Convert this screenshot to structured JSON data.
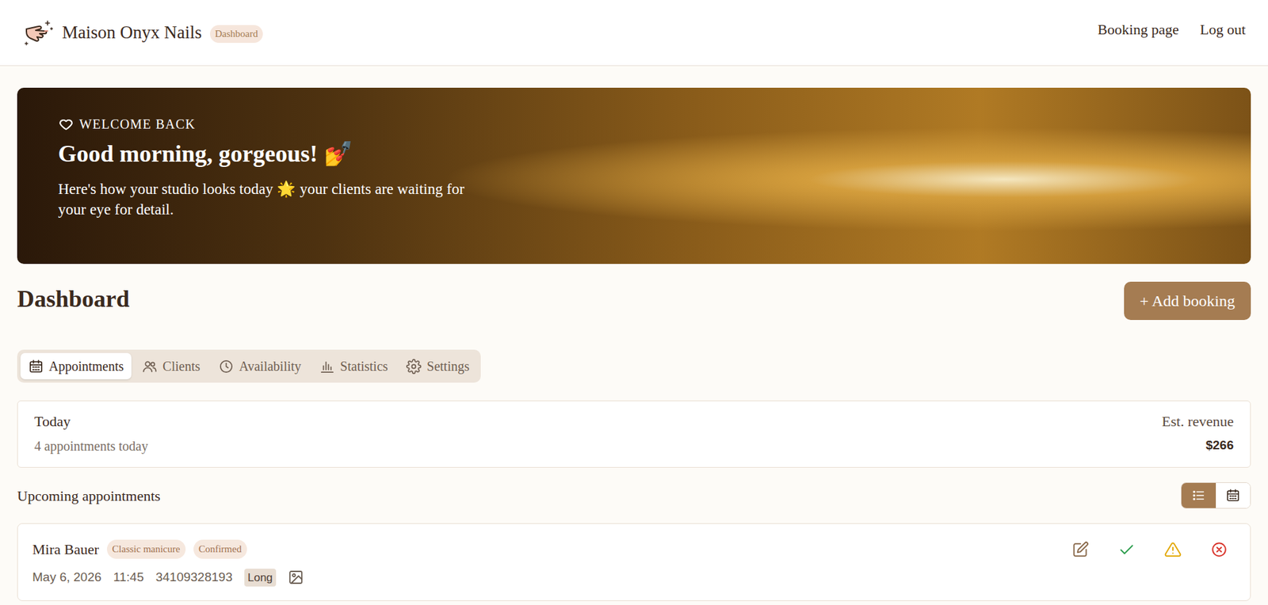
{
  "header": {
    "brand": "Maison Onyx Nails",
    "badge": "Dashboard",
    "nav": [
      "Booking page",
      "Log out"
    ]
  },
  "hero": {
    "eyebrow": "WELCOME BACK",
    "title": "Good morning, gorgeous! 💅",
    "subtitle": "Here's how your studio looks today 🌟 your clients are waiting for your eye for detail."
  },
  "page": {
    "title": "Dashboard",
    "add_button": "+ Add booking"
  },
  "tabs": [
    {
      "label": "Appointments",
      "selected": true
    },
    {
      "label": "Clients",
      "selected": false
    },
    {
      "label": "Availability",
      "selected": false
    },
    {
      "label": "Statistics",
      "selected": false
    },
    {
      "label": "Settings",
      "selected": false
    }
  ],
  "today": {
    "title": "Today",
    "count": "4 appointments today",
    "revenue_label": "Est. revenue",
    "revenue": "$266"
  },
  "upcoming": {
    "title": "Upcoming appointments",
    "views": [
      {
        "kind": "list",
        "selected": true
      },
      {
        "kind": "calendar",
        "selected": false
      }
    ]
  },
  "appointments": [
    {
      "name": "Mira Bauer",
      "service": "Classic manicure",
      "status": "Confirmed",
      "date": "May 6, 2026",
      "time": "11:45",
      "phone": "34109328193",
      "length": "Long"
    }
  ]
}
